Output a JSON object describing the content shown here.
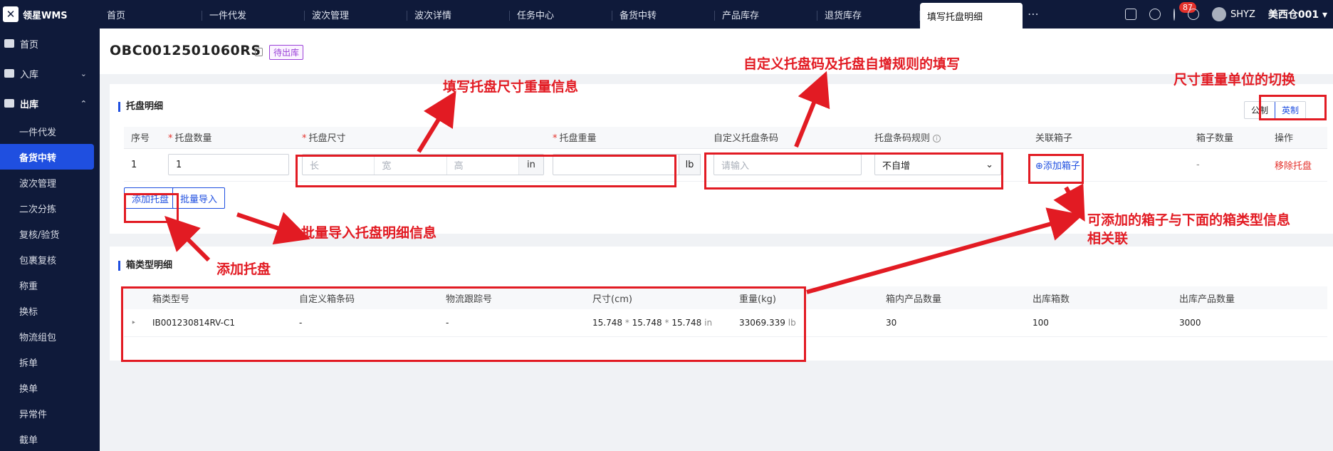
{
  "app": {
    "name": "领星WMS"
  },
  "tabs": [
    "首页",
    "一件代发",
    "波次管理",
    "波次详情",
    "任务中心",
    "备货中转",
    "产品库存",
    "退货库存",
    "填写托盘明细"
  ],
  "topbar": {
    "notifications": "87",
    "user": "SHYZ",
    "warehouse": "美西仓001 ▾"
  },
  "sidebar": {
    "top": [
      {
        "label": "首页",
        "chevron": ""
      },
      {
        "label": "入库",
        "chevron": "⌄"
      },
      {
        "label": "出库",
        "chevron": "⌃"
      }
    ],
    "sub": [
      "一件代发",
      "备货中转",
      "波次管理",
      "二次分拣",
      "复核/验货",
      "包裹复核",
      "称重",
      "换标",
      "物流组包",
      "拆单",
      "换单",
      "异常件",
      "截单"
    ]
  },
  "order": {
    "number": "OBC0012501060RS",
    "status": "待出库"
  },
  "pallet_card": {
    "title": "托盘明细",
    "unit_metric": "公制",
    "unit_imperial": "英制",
    "headers": [
      "序号",
      "托盘数量",
      "托盘尺寸",
      "托盘重量",
      "自定义托盘条码",
      "托盘条码规则",
      "关联箱子",
      "箱子数量",
      "操作"
    ],
    "required_mark": "*",
    "info_mark": "i",
    "row": {
      "index": "1",
      "qty": "1",
      "len_ph": "长",
      "wid_ph": "宽",
      "hei_ph": "高",
      "size_unit": "in",
      "weight_unit": "lb",
      "barcode_ph": "请输入",
      "rule": "不自增",
      "rule_arrow": "⌄",
      "add_box": "⊕添加箱子",
      "box_count": "-",
      "remove": "移除托盘"
    },
    "add_btn": "添加托盘",
    "import_btn": "批量导入"
  },
  "box_card": {
    "title": "箱类型明细",
    "headers": [
      "箱类型号",
      "自定义箱条码",
      "物流跟踪号",
      "尺寸(cm)",
      "重量(kg)",
      "箱内产品数量",
      "出库箱数",
      "出库产品数量"
    ],
    "row": {
      "expand": "‣",
      "type": "IB001230814RV-C1",
      "barcode": "-",
      "tracking": "-",
      "l": "15.748",
      "w": "15.748",
      "h": "15.748",
      "times": "*",
      "size_unit": "in",
      "weight": "33069.339",
      "weight_unit": "lb",
      "inner_qty": "30",
      "box_count": "100",
      "product_qty": "3000"
    }
  },
  "annotations": {
    "size_weight": "填写托盘尺寸重量信息",
    "barcode_rule": "自定义托盘码及托盘自增规则的填写",
    "unit_switch": "尺寸重量单位的切换",
    "batch_import": "批量导入托盘明细信息",
    "add_pallet": "添加托盘",
    "box_link_1": "可添加的箱子与下面的箱类型信息",
    "box_link_2": "相关联"
  },
  "colors": {
    "nav": "#0f1a3a",
    "accent": "#1f4fe0",
    "annotation": "#e21b23"
  }
}
